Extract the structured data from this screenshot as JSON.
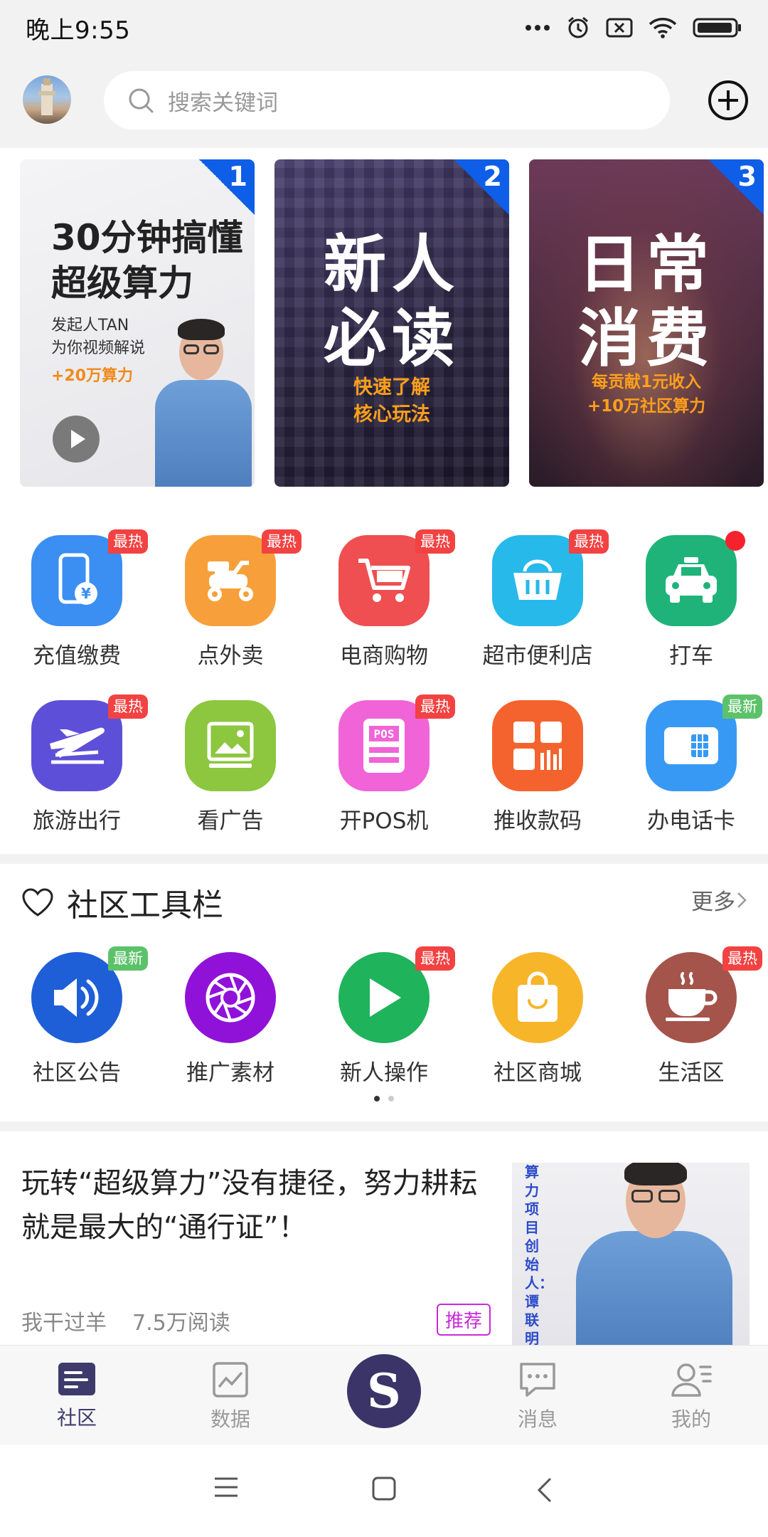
{
  "status_bar": {
    "time": "晚上9:55"
  },
  "header": {
    "search_placeholder": "搜索关键词"
  },
  "banners": [
    {
      "number": "1",
      "title_line1": "30分钟搞懂",
      "title_line2": "超级算力",
      "sub_line1": "发起人TAN",
      "sub_line2": "为你视频解说",
      "bonus": "+20万算力"
    },
    {
      "number": "2",
      "title_line1": "新人",
      "title_line2": "必读",
      "sub_line1": "快速了解",
      "sub_line2": "核心玩法"
    },
    {
      "number": "3",
      "title_line1": "日常",
      "title_line2": "消费",
      "sub_line1": "每贡献1元收入",
      "sub_line2": "+10万社区算力"
    }
  ],
  "services": [
    {
      "label": "充值缴费",
      "badge": "最热",
      "color": "#3b8ef2",
      "icon": "phone-recharge-icon"
    },
    {
      "label": "点外卖",
      "badge": "最热",
      "color": "#f7a03b",
      "icon": "scooter-icon"
    },
    {
      "label": "电商购物",
      "badge": "最热",
      "color": "#ef4f51",
      "icon": "cart-icon"
    },
    {
      "label": "超市便利店",
      "badge": "最热",
      "color": "#27b9ea",
      "icon": "basket-icon"
    },
    {
      "label": "打车",
      "badge": "",
      "color": "#1fb37a",
      "icon": "taxi-icon"
    },
    {
      "label": "旅游出行",
      "badge": "最热",
      "color": "#5e4fd9",
      "icon": "plane-icon"
    },
    {
      "label": "看广告",
      "badge": "",
      "color": "#8dc63f",
      "icon": "image-ad-icon"
    },
    {
      "label": "开POS机",
      "badge": "最热",
      "color": "#f064d8",
      "icon": "pos-icon"
    },
    {
      "label": "推收款码",
      "badge": "",
      "color": "#f4632d",
      "icon": "qrcode-icon"
    },
    {
      "label": "办电话卡",
      "badge": "最新",
      "color": "#3899f5",
      "icon": "sim-card-icon"
    }
  ],
  "toolbar": {
    "title": "社区工具栏",
    "more": "更多",
    "items": [
      {
        "label": "社区公告",
        "badge": "最新",
        "color": "#1e5fd8",
        "icon": "speaker-icon"
      },
      {
        "label": "推广素材",
        "badge": "",
        "color": "#9012d9",
        "icon": "aperture-icon"
      },
      {
        "label": "新人操作",
        "badge": "最热",
        "color": "#1fb35c",
        "icon": "play-icon"
      },
      {
        "label": "社区商城",
        "badge": "",
        "color": "#f7b52a",
        "icon": "shopping-bag-icon"
      },
      {
        "label": "生活区",
        "badge": "最热",
        "color": "#a4544a",
        "icon": "coffee-icon"
      }
    ]
  },
  "article": {
    "title": "玩转“超级算力”没有捷径，努力耕耘就是最大的“通行证”！",
    "author": "我干过羊",
    "reads": "7.5万阅读",
    "tag": "推荐",
    "image_text": "算力项目创始人：谭联明"
  },
  "tabbar": {
    "tabs": [
      {
        "label": "社区"
      },
      {
        "label": "数据"
      },
      {
        "label": ""
      },
      {
        "label": "消息"
      },
      {
        "label": "我的"
      }
    ],
    "center_symbol": "S"
  }
}
